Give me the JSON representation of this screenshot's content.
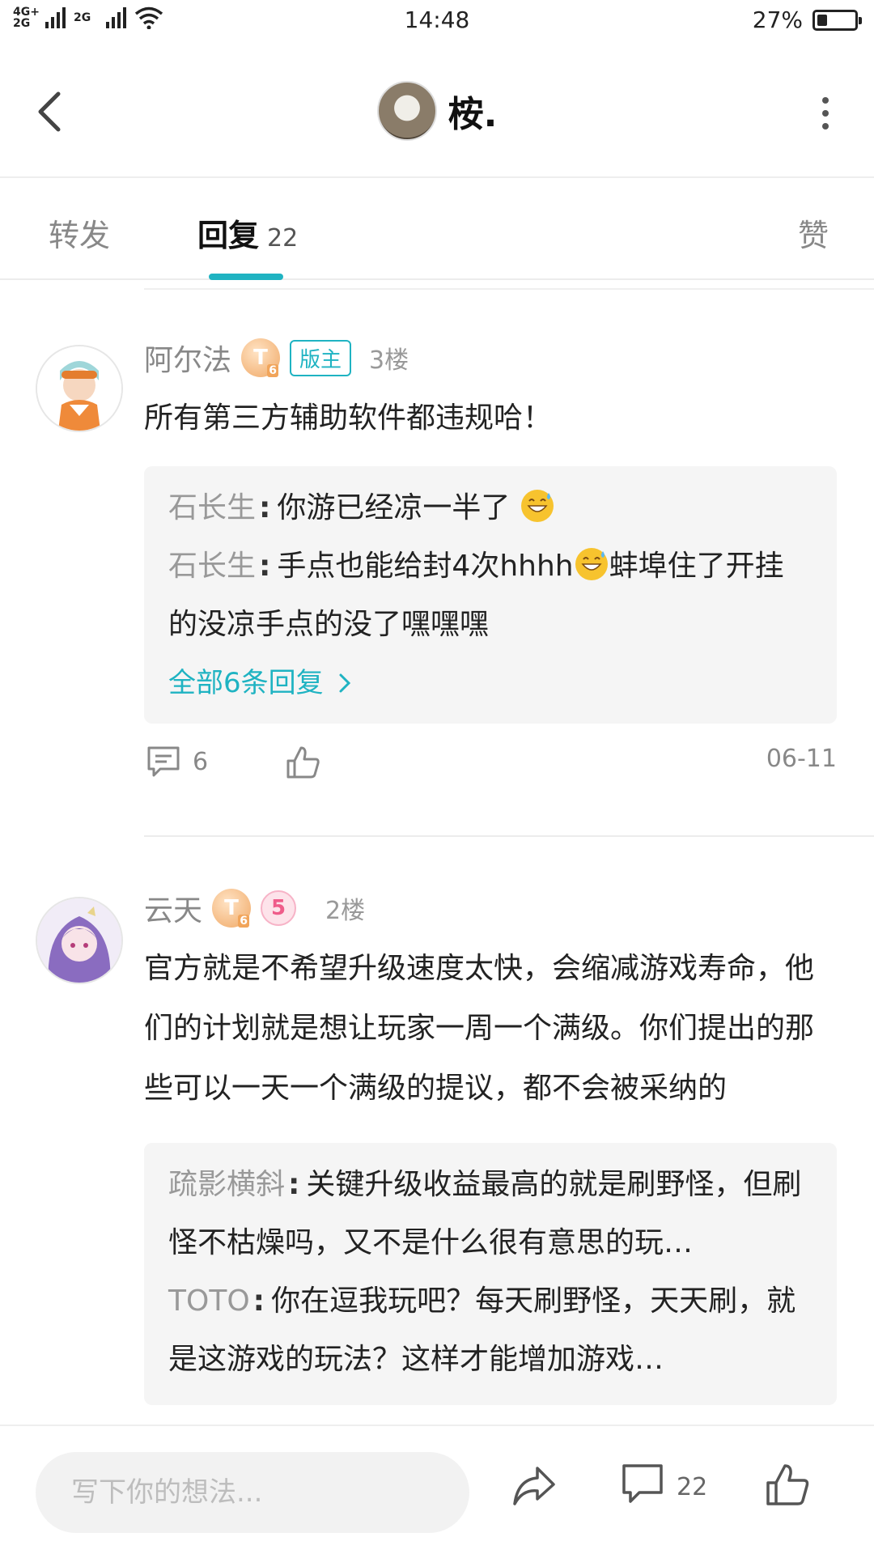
{
  "status": {
    "network1": "4G+\n2G",
    "network2": "2G",
    "time": "14:48",
    "battery": "27%",
    "battery_level": 0.27
  },
  "header": {
    "title": "桉."
  },
  "tabs": {
    "repost": "转发",
    "reply": "回复",
    "reply_count": "22",
    "like": "赞"
  },
  "comments": [
    {
      "user": "阿尔法",
      "level": "T",
      "level_num": "6",
      "badge": "版主",
      "floor": "3楼",
      "text": "所有第三方辅助软件都违规哈！",
      "replies": [
        {
          "name": "石长生",
          "text": "你游已经凉一半了"
        },
        {
          "name": "石长生",
          "text_a": "手点也能给封4次hhhh",
          "text_b": "蚌埠住了开挂的没凉手点的没了嘿嘿嘿"
        }
      ],
      "more": "全部6条回复",
      "comment_count": "6",
      "date": "06-11"
    },
    {
      "user": "云天",
      "level": "T",
      "level_num": "6",
      "fans_badge": "5",
      "floor": "2楼",
      "text": "官方就是不希望升级速度太快，会缩减游戏寿命，他们的计划就是想让玩家一周一个满级。你们提出的那些可以一天一个满级的提议，都不会被采纳的",
      "replies": [
        {
          "name": "疏影横斜",
          "text": "关键升级收益最高的就是刷野怪，但刷怪不枯燥吗，又不是什么很有意思的玩…"
        },
        {
          "name": "TOTO",
          "text": "你在逗我玩吧？每天刷野怪，天天刷，就是这游戏的玩法？这样才能增加游戏…"
        }
      ]
    }
  ],
  "bottom": {
    "placeholder": "写下你的想法...",
    "comment_count": "22"
  },
  "colors": {
    "accent": "#1fb3c2"
  }
}
